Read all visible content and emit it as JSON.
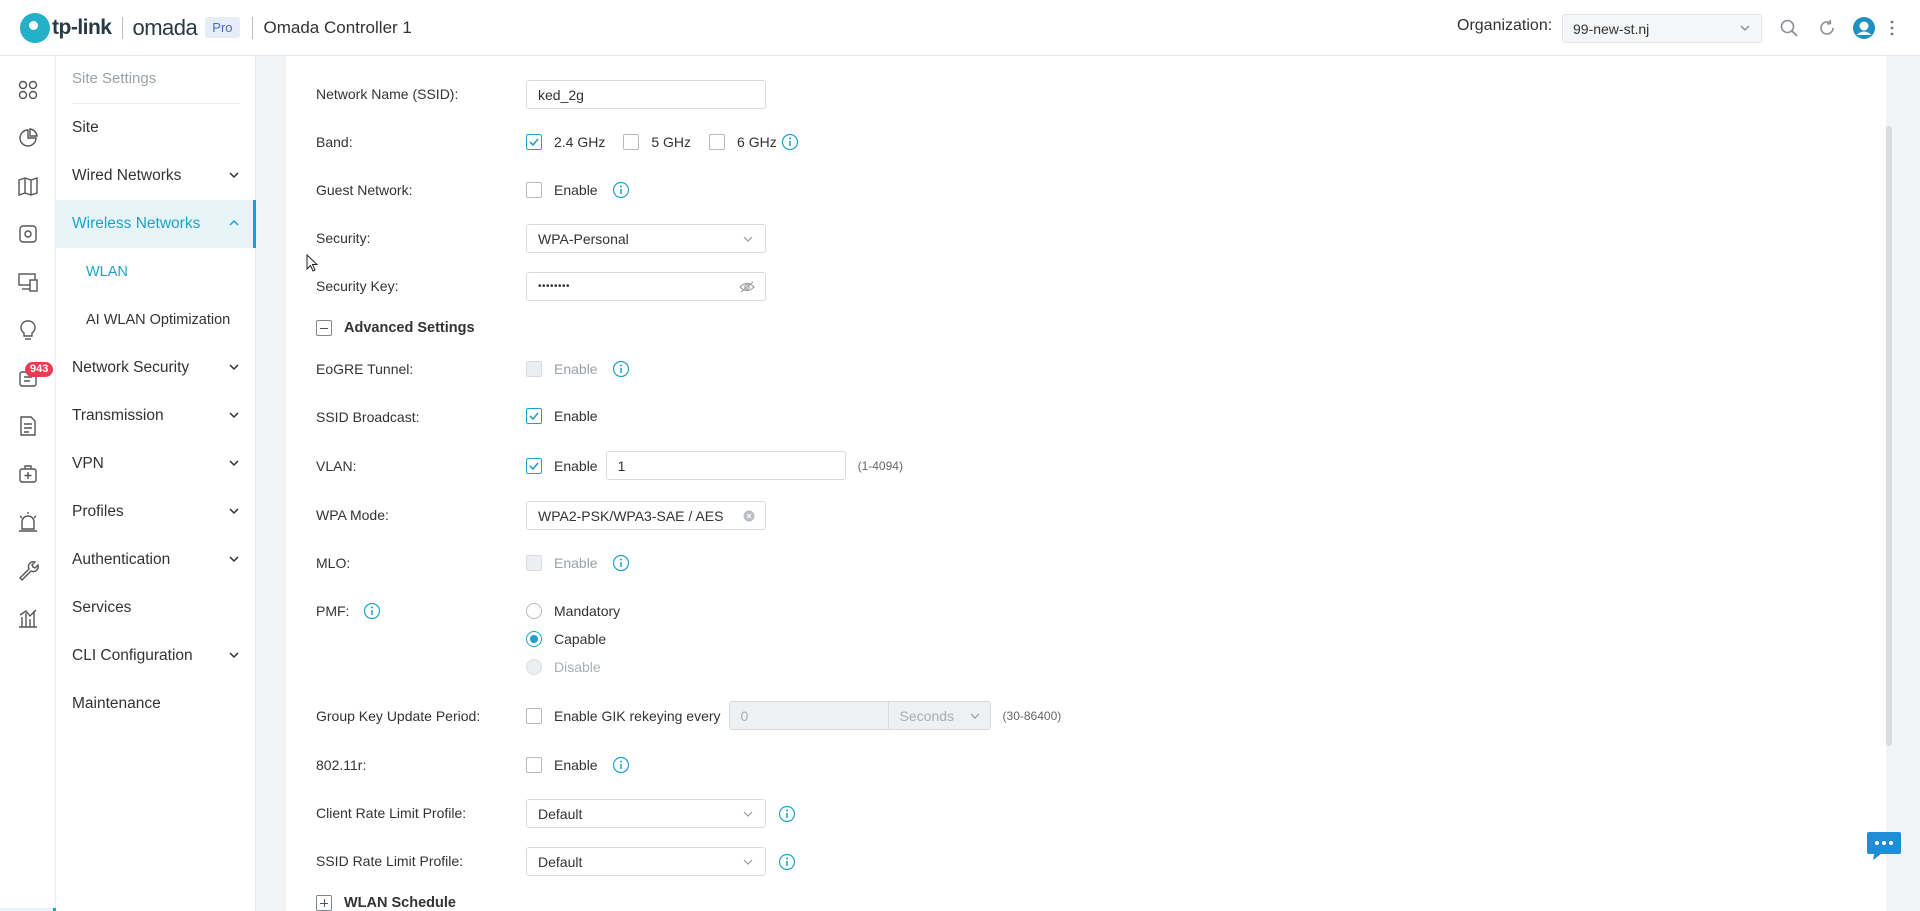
{
  "header": {
    "logo_brand": "tp-link",
    "logo_product": "omada",
    "logo_badge": "Pro",
    "controller_name": "Omada Controller 1",
    "org_label": "Organization:",
    "org_value": "99-new-st.nj"
  },
  "rail": {
    "icons": [
      "dashboard-icon",
      "statistics-icon",
      "map-icon",
      "devices-icon",
      "clients-icon",
      "insights-icon",
      "logs-icon",
      "reports-icon",
      "tools-icon",
      "alerts-icon",
      "maintenance-icon",
      "analytics-icon",
      "settings-icon"
    ],
    "badge": "943"
  },
  "menu": {
    "title": "Site Settings",
    "items": [
      {
        "label": "Site"
      },
      {
        "label": "Wired Networks"
      },
      {
        "label": "Wireless Networks"
      },
      {
        "label": "Network Security"
      },
      {
        "label": "Transmission"
      },
      {
        "label": "VPN"
      },
      {
        "label": "Profiles"
      },
      {
        "label": "Authentication"
      },
      {
        "label": "Services"
      },
      {
        "label": "CLI Configuration"
      },
      {
        "label": "Maintenance"
      }
    ],
    "sub_items": [
      {
        "label": "WLAN"
      },
      {
        "label": "AI WLAN Optimization"
      }
    ]
  },
  "form": {
    "ssid": {
      "label": "Network Name (SSID):",
      "value": "ked_2g"
    },
    "band": {
      "label": "Band:",
      "options": [
        "2.4 GHz",
        "5 GHz",
        "6 GHz"
      ],
      "checked": "2.4 GHz"
    },
    "guest": {
      "label": "Guest Network:",
      "option": "Enable"
    },
    "security": {
      "label": "Security:",
      "value": "WPA-Personal"
    },
    "security_key": {
      "label": "Security Key:",
      "value": "••••••••"
    },
    "advanced_settings": "Advanced Settings",
    "eogre": {
      "label": "EoGRE Tunnel:",
      "option": "Enable"
    },
    "ssid_broadcast": {
      "label": "SSID Broadcast:",
      "option": "Enable"
    },
    "vlan": {
      "label": "VLAN:",
      "option": "Enable",
      "value": "1",
      "range": "(1-4094)"
    },
    "wpa_mode": {
      "label": "WPA Mode:",
      "value": "WPA2-PSK/WPA3-SAE / AES"
    },
    "mlo": {
      "label": "MLO:",
      "option": "Enable"
    },
    "pmf": {
      "label": "PMF:",
      "options": [
        "Mandatory",
        "Capable",
        "Disable"
      ],
      "selected": "Capable"
    },
    "gik": {
      "label": "Group Key Update Period:",
      "option": "Enable GIK rekeying every",
      "value": "0",
      "unit": "Seconds",
      "range": "(30-86400)"
    },
    "r80211": {
      "label": "802.11r:",
      "option": "Enable"
    },
    "client_rate": {
      "label": "Client Rate Limit Profile:",
      "value": "Default"
    },
    "ssid_rate": {
      "label": "SSID Rate Limit Profile:",
      "value": "Default"
    },
    "wlan_schedule": "WLAN Schedule"
  },
  "colors": {
    "accent": "#1ea1cc",
    "badge": "#ee3b55",
    "logo": "#22b1c9"
  }
}
